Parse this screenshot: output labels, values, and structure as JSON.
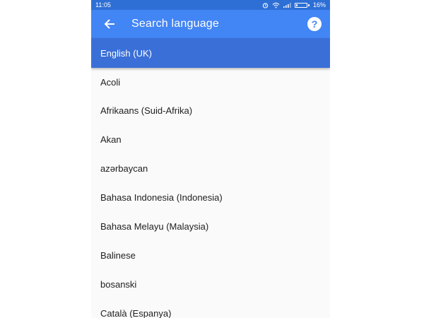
{
  "status_bar": {
    "time": "11:05",
    "battery_percent": "16%",
    "battery_level": 0.16,
    "icons": [
      "alarm-icon",
      "wifi-icon",
      "signal-icon",
      "battery-icon"
    ]
  },
  "app_bar": {
    "title": "Search language",
    "back_icon": "arrow-left-icon",
    "help_icon": "help-icon",
    "help_glyph": "?"
  },
  "selected_language": "English (UK)",
  "languages": [
    "Acoli",
    "Afrikaans (Suid-Afrika)",
    "Akan",
    "azərbaycan",
    "Bahasa Indonesia (Indonesia)",
    "Bahasa Melayu (Malaysia)",
    "Balinese",
    "bosanski",
    "Català (Espanya)"
  ],
  "colors": {
    "app_bar": "#4285f4",
    "status_bar": "#2e6fd6",
    "selected_row": "#3a6fd8",
    "list_background": "#fafafa",
    "text": "#212121"
  }
}
